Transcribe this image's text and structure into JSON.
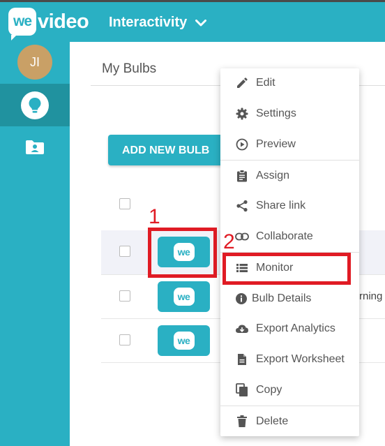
{
  "topbar": {
    "logo_word_a": "we",
    "logo_word_b": "video",
    "workspace": "Interactivity"
  },
  "sidebar": {
    "avatar_initials": "JI"
  },
  "main": {
    "title": "My Bulbs",
    "add_button": "ADD NEW BULB",
    "clipped_text": "rning"
  },
  "thumb_logo": "we",
  "annotations": {
    "first": "1",
    "second": "2"
  },
  "menu": {
    "edit": "Edit",
    "settings": "Settings",
    "preview": "Preview",
    "assign": "Assign",
    "share_link": "Share link",
    "collaborate": "Collaborate",
    "monitor": "Monitor",
    "bulb_details": "Bulb Details",
    "export_analytics": "Export Analytics",
    "export_worksheet": "Export Worksheet",
    "copy": "Copy",
    "delete": "Delete"
  },
  "colors": {
    "brand": "#2ab0c3",
    "annotation": "#e01b24",
    "avatar": "#c9a066"
  }
}
